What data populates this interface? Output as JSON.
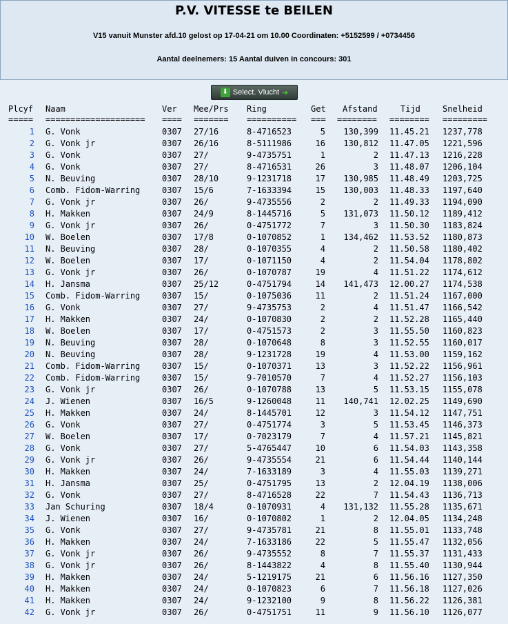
{
  "header": {
    "title": "P.V. VITESSE te BEILEN",
    "subtitle": "V15 vanuit Munster afd.10 gelost op 17-04-21 om 10.00 Coordinaten: +5152599 / +0734456",
    "counts": "Aantal deelnemers: 15 Aantal duiven in concours: 301"
  },
  "toolbar": {
    "select_label": "Select. Vlucht",
    "select_icon": "download-icon",
    "arrow_icon": "arrow-right-icon"
  },
  "columns": {
    "plc": "Plcyf",
    "naam": "Naam",
    "ver": "Ver",
    "mee": "Mee/Prs",
    "ring": "Ring",
    "get": "Get",
    "afst": "Afstand",
    "tijd": "Tijd",
    "snel": "Snelheid"
  },
  "separators": {
    "plc": "=====",
    "naam": "====================",
    "ver": "====",
    "mee": "=======",
    "ring": "==========",
    "get": "===",
    "afst": "========",
    "tijd": "========",
    "snel": "========="
  },
  "rows": [
    {
      "plc": "1",
      "naam": "G. Vonk",
      "ver": "0307",
      "mee": "27/16",
      "ring": "8-4716523",
      "get": "5",
      "afst": "130,399",
      "tijd": "11.45.21",
      "snel": "1237,778"
    },
    {
      "plc": "2",
      "naam": "G. Vonk jr",
      "ver": "0307",
      "mee": "26/16",
      "ring": "8-5111986",
      "get": "16",
      "afst": "130,812",
      "tijd": "11.47.05",
      "snel": "1221,596"
    },
    {
      "plc": "3",
      "naam": "G. Vonk",
      "ver": "0307",
      "mee": "27/",
      "ring": "9-4735751",
      "get": "1",
      "afst": "2",
      "tijd": "11.47.13",
      "snel": "1216,228"
    },
    {
      "plc": "4",
      "naam": "G. Vonk",
      "ver": "0307",
      "mee": "27/",
      "ring": "8-4716531",
      "get": "26",
      "afst": "3",
      "tijd": "11.48.07",
      "snel": "1206,104"
    },
    {
      "plc": "5",
      "naam": "N. Beuving",
      "ver": "0307",
      "mee": "28/10",
      "ring": "9-1231718",
      "get": "17",
      "afst": "130,985",
      "tijd": "11.48.49",
      "snel": "1203,725"
    },
    {
      "plc": "6",
      "naam": "Comb. Fidom-Warring",
      "ver": "0307",
      "mee": "15/6",
      "ring": "7-1633394",
      "get": "15",
      "afst": "130,003",
      "tijd": "11.48.33",
      "snel": "1197,640"
    },
    {
      "plc": "7",
      "naam": "G. Vonk jr",
      "ver": "0307",
      "mee": "26/",
      "ring": "9-4735556",
      "get": "2",
      "afst": "2",
      "tijd": "11.49.33",
      "snel": "1194,090"
    },
    {
      "plc": "8",
      "naam": "H. Makken",
      "ver": "0307",
      "mee": "24/9",
      "ring": "8-1445716",
      "get": "5",
      "afst": "131,073",
      "tijd": "11.50.12",
      "snel": "1189,412"
    },
    {
      "plc": "9",
      "naam": "G. Vonk jr",
      "ver": "0307",
      "mee": "26/",
      "ring": "0-4751772",
      "get": "7",
      "afst": "3",
      "tijd": "11.50.30",
      "snel": "1183,824"
    },
    {
      "plc": "10",
      "naam": "W. Boelen",
      "ver": "0307",
      "mee": "17/8",
      "ring": "0-1070852",
      "get": "1",
      "afst": "134,462",
      "tijd": "11.53.52",
      "snel": "1180,873"
    },
    {
      "plc": "11",
      "naam": "N. Beuving",
      "ver": "0307",
      "mee": "28/",
      "ring": "0-1070355",
      "get": "4",
      "afst": "2",
      "tijd": "11.50.58",
      "snel": "1180,402"
    },
    {
      "plc": "12",
      "naam": "W. Boelen",
      "ver": "0307",
      "mee": "17/",
      "ring": "0-1071150",
      "get": "4",
      "afst": "2",
      "tijd": "11.54.04",
      "snel": "1178,802"
    },
    {
      "plc": "13",
      "naam": "G. Vonk jr",
      "ver": "0307",
      "mee": "26/",
      "ring": "0-1070787",
      "get": "19",
      "afst": "4",
      "tijd": "11.51.22",
      "snel": "1174,612"
    },
    {
      "plc": "14",
      "naam": "H. Jansma",
      "ver": "0307",
      "mee": "25/12",
      "ring": "0-4751794",
      "get": "14",
      "afst": "141,473",
      "tijd": "12.00.27",
      "snel": "1174,538"
    },
    {
      "plc": "15",
      "naam": "Comb. Fidom-Warring",
      "ver": "0307",
      "mee": "15/",
      "ring": "0-1075036",
      "get": "11",
      "afst": "2",
      "tijd": "11.51.24",
      "snel": "1167,000"
    },
    {
      "plc": "16",
      "naam": "G. Vonk",
      "ver": "0307",
      "mee": "27/",
      "ring": "9-4735753",
      "get": "2",
      "afst": "4",
      "tijd": "11.51.47",
      "snel": "1166,542"
    },
    {
      "plc": "17",
      "naam": "H. Makken",
      "ver": "0307",
      "mee": "24/",
      "ring": "0-1070830",
      "get": "2",
      "afst": "2",
      "tijd": "11.52.28",
      "snel": "1165,440"
    },
    {
      "plc": "18",
      "naam": "W. Boelen",
      "ver": "0307",
      "mee": "17/",
      "ring": "0-4751573",
      "get": "2",
      "afst": "3",
      "tijd": "11.55.50",
      "snel": "1160,823"
    },
    {
      "plc": "19",
      "naam": "N. Beuving",
      "ver": "0307",
      "mee": "28/",
      "ring": "0-1070648",
      "get": "8",
      "afst": "3",
      "tijd": "11.52.55",
      "snel": "1160,017"
    },
    {
      "plc": "20",
      "naam": "N. Beuving",
      "ver": "0307",
      "mee": "28/",
      "ring": "9-1231728",
      "get": "19",
      "afst": "4",
      "tijd": "11.53.00",
      "snel": "1159,162"
    },
    {
      "plc": "21",
      "naam": "Comb. Fidom-Warring",
      "ver": "0307",
      "mee": "15/",
      "ring": "0-1070371",
      "get": "13",
      "afst": "3",
      "tijd": "11.52.22",
      "snel": "1156,961"
    },
    {
      "plc": "22",
      "naam": "Comb. Fidom-Warring",
      "ver": "0307",
      "mee": "15/",
      "ring": "9-7010570",
      "get": "7",
      "afst": "4",
      "tijd": "11.52.27",
      "snel": "1156,103"
    },
    {
      "plc": "23",
      "naam": "G. Vonk jr",
      "ver": "0307",
      "mee": "26/",
      "ring": "0-1070788",
      "get": "13",
      "afst": "5",
      "tijd": "11.53.15",
      "snel": "1155,078"
    },
    {
      "plc": "24",
      "naam": "J. Wienen",
      "ver": "0307",
      "mee": "16/5",
      "ring": "9-1260048",
      "get": "11",
      "afst": "140,741",
      "tijd": "12.02.25",
      "snel": "1149,690"
    },
    {
      "plc": "25",
      "naam": "H. Makken",
      "ver": "0307",
      "mee": "24/",
      "ring": "8-1445701",
      "get": "12",
      "afst": "3",
      "tijd": "11.54.12",
      "snel": "1147,751"
    },
    {
      "plc": "26",
      "naam": "G. Vonk",
      "ver": "0307",
      "mee": "27/",
      "ring": "0-4751774",
      "get": "3",
      "afst": "5",
      "tijd": "11.53.45",
      "snel": "1146,373"
    },
    {
      "plc": "27",
      "naam": "W. Boelen",
      "ver": "0307",
      "mee": "17/",
      "ring": "0-7023179",
      "get": "7",
      "afst": "4",
      "tijd": "11.57.21",
      "snel": "1145,821"
    },
    {
      "plc": "28",
      "naam": "G. Vonk",
      "ver": "0307",
      "mee": "27/",
      "ring": "5-4765447",
      "get": "10",
      "afst": "6",
      "tijd": "11.54.03",
      "snel": "1143,358"
    },
    {
      "plc": "29",
      "naam": "G. Vonk jr",
      "ver": "0307",
      "mee": "26/",
      "ring": "9-4735554",
      "get": "21",
      "afst": "6",
      "tijd": "11.54.44",
      "snel": "1140,144"
    },
    {
      "plc": "30",
      "naam": "H. Makken",
      "ver": "0307",
      "mee": "24/",
      "ring": "7-1633189",
      "get": "3",
      "afst": "4",
      "tijd": "11.55.03",
      "snel": "1139,271"
    },
    {
      "plc": "31",
      "naam": "H. Jansma",
      "ver": "0307",
      "mee": "25/",
      "ring": "0-4751795",
      "get": "13",
      "afst": "2",
      "tijd": "12.04.19",
      "snel": "1138,006"
    },
    {
      "plc": "32",
      "naam": "G. Vonk",
      "ver": "0307",
      "mee": "27/",
      "ring": "8-4716528",
      "get": "22",
      "afst": "7",
      "tijd": "11.54.43",
      "snel": "1136,713"
    },
    {
      "plc": "33",
      "naam": "Jan Schuring",
      "ver": "0307",
      "mee": "18/4",
      "ring": "0-1070931",
      "get": "4",
      "afst": "131,132",
      "tijd": "11.55.28",
      "snel": "1135,671"
    },
    {
      "plc": "34",
      "naam": "J. Wienen",
      "ver": "0307",
      "mee": "16/",
      "ring": "0-1070802",
      "get": "1",
      "afst": "2",
      "tijd": "12.04.05",
      "snel": "1134,248"
    },
    {
      "plc": "35",
      "naam": "G. Vonk",
      "ver": "0307",
      "mee": "27/",
      "ring": "9-4735781",
      "get": "21",
      "afst": "8",
      "tijd": "11.55.01",
      "snel": "1133,748"
    },
    {
      "plc": "36",
      "naam": "H. Makken",
      "ver": "0307",
      "mee": "24/",
      "ring": "7-1633186",
      "get": "22",
      "afst": "5",
      "tijd": "11.55.47",
      "snel": "1132,056"
    },
    {
      "plc": "37",
      "naam": "G. Vonk jr",
      "ver": "0307",
      "mee": "26/",
      "ring": "9-4735552",
      "get": "8",
      "afst": "7",
      "tijd": "11.55.37",
      "snel": "1131,433"
    },
    {
      "plc": "38",
      "naam": "G. Vonk jr",
      "ver": "0307",
      "mee": "26/",
      "ring": "8-1443822",
      "get": "4",
      "afst": "8",
      "tijd": "11.55.40",
      "snel": "1130,944"
    },
    {
      "plc": "39",
      "naam": "H. Makken",
      "ver": "0307",
      "mee": "24/",
      "ring": "5-1219175",
      "get": "21",
      "afst": "6",
      "tijd": "11.56.16",
      "snel": "1127,350"
    },
    {
      "plc": "40",
      "naam": "H. Makken",
      "ver": "0307",
      "mee": "24/",
      "ring": "0-1070823",
      "get": "6",
      "afst": "7",
      "tijd": "11.56.18",
      "snel": "1127,026"
    },
    {
      "plc": "41",
      "naam": "H. Makken",
      "ver": "0307",
      "mee": "24/",
      "ring": "9-1232100",
      "get": "9",
      "afst": "8",
      "tijd": "11.56.22",
      "snel": "1126,381"
    },
    {
      "plc": "42",
      "naam": "G. Vonk jr",
      "ver": "0307",
      "mee": "26/",
      "ring": "0-4751751",
      "get": "11",
      "afst": "9",
      "tijd": "11.56.10",
      "snel": "1126,077"
    }
  ]
}
